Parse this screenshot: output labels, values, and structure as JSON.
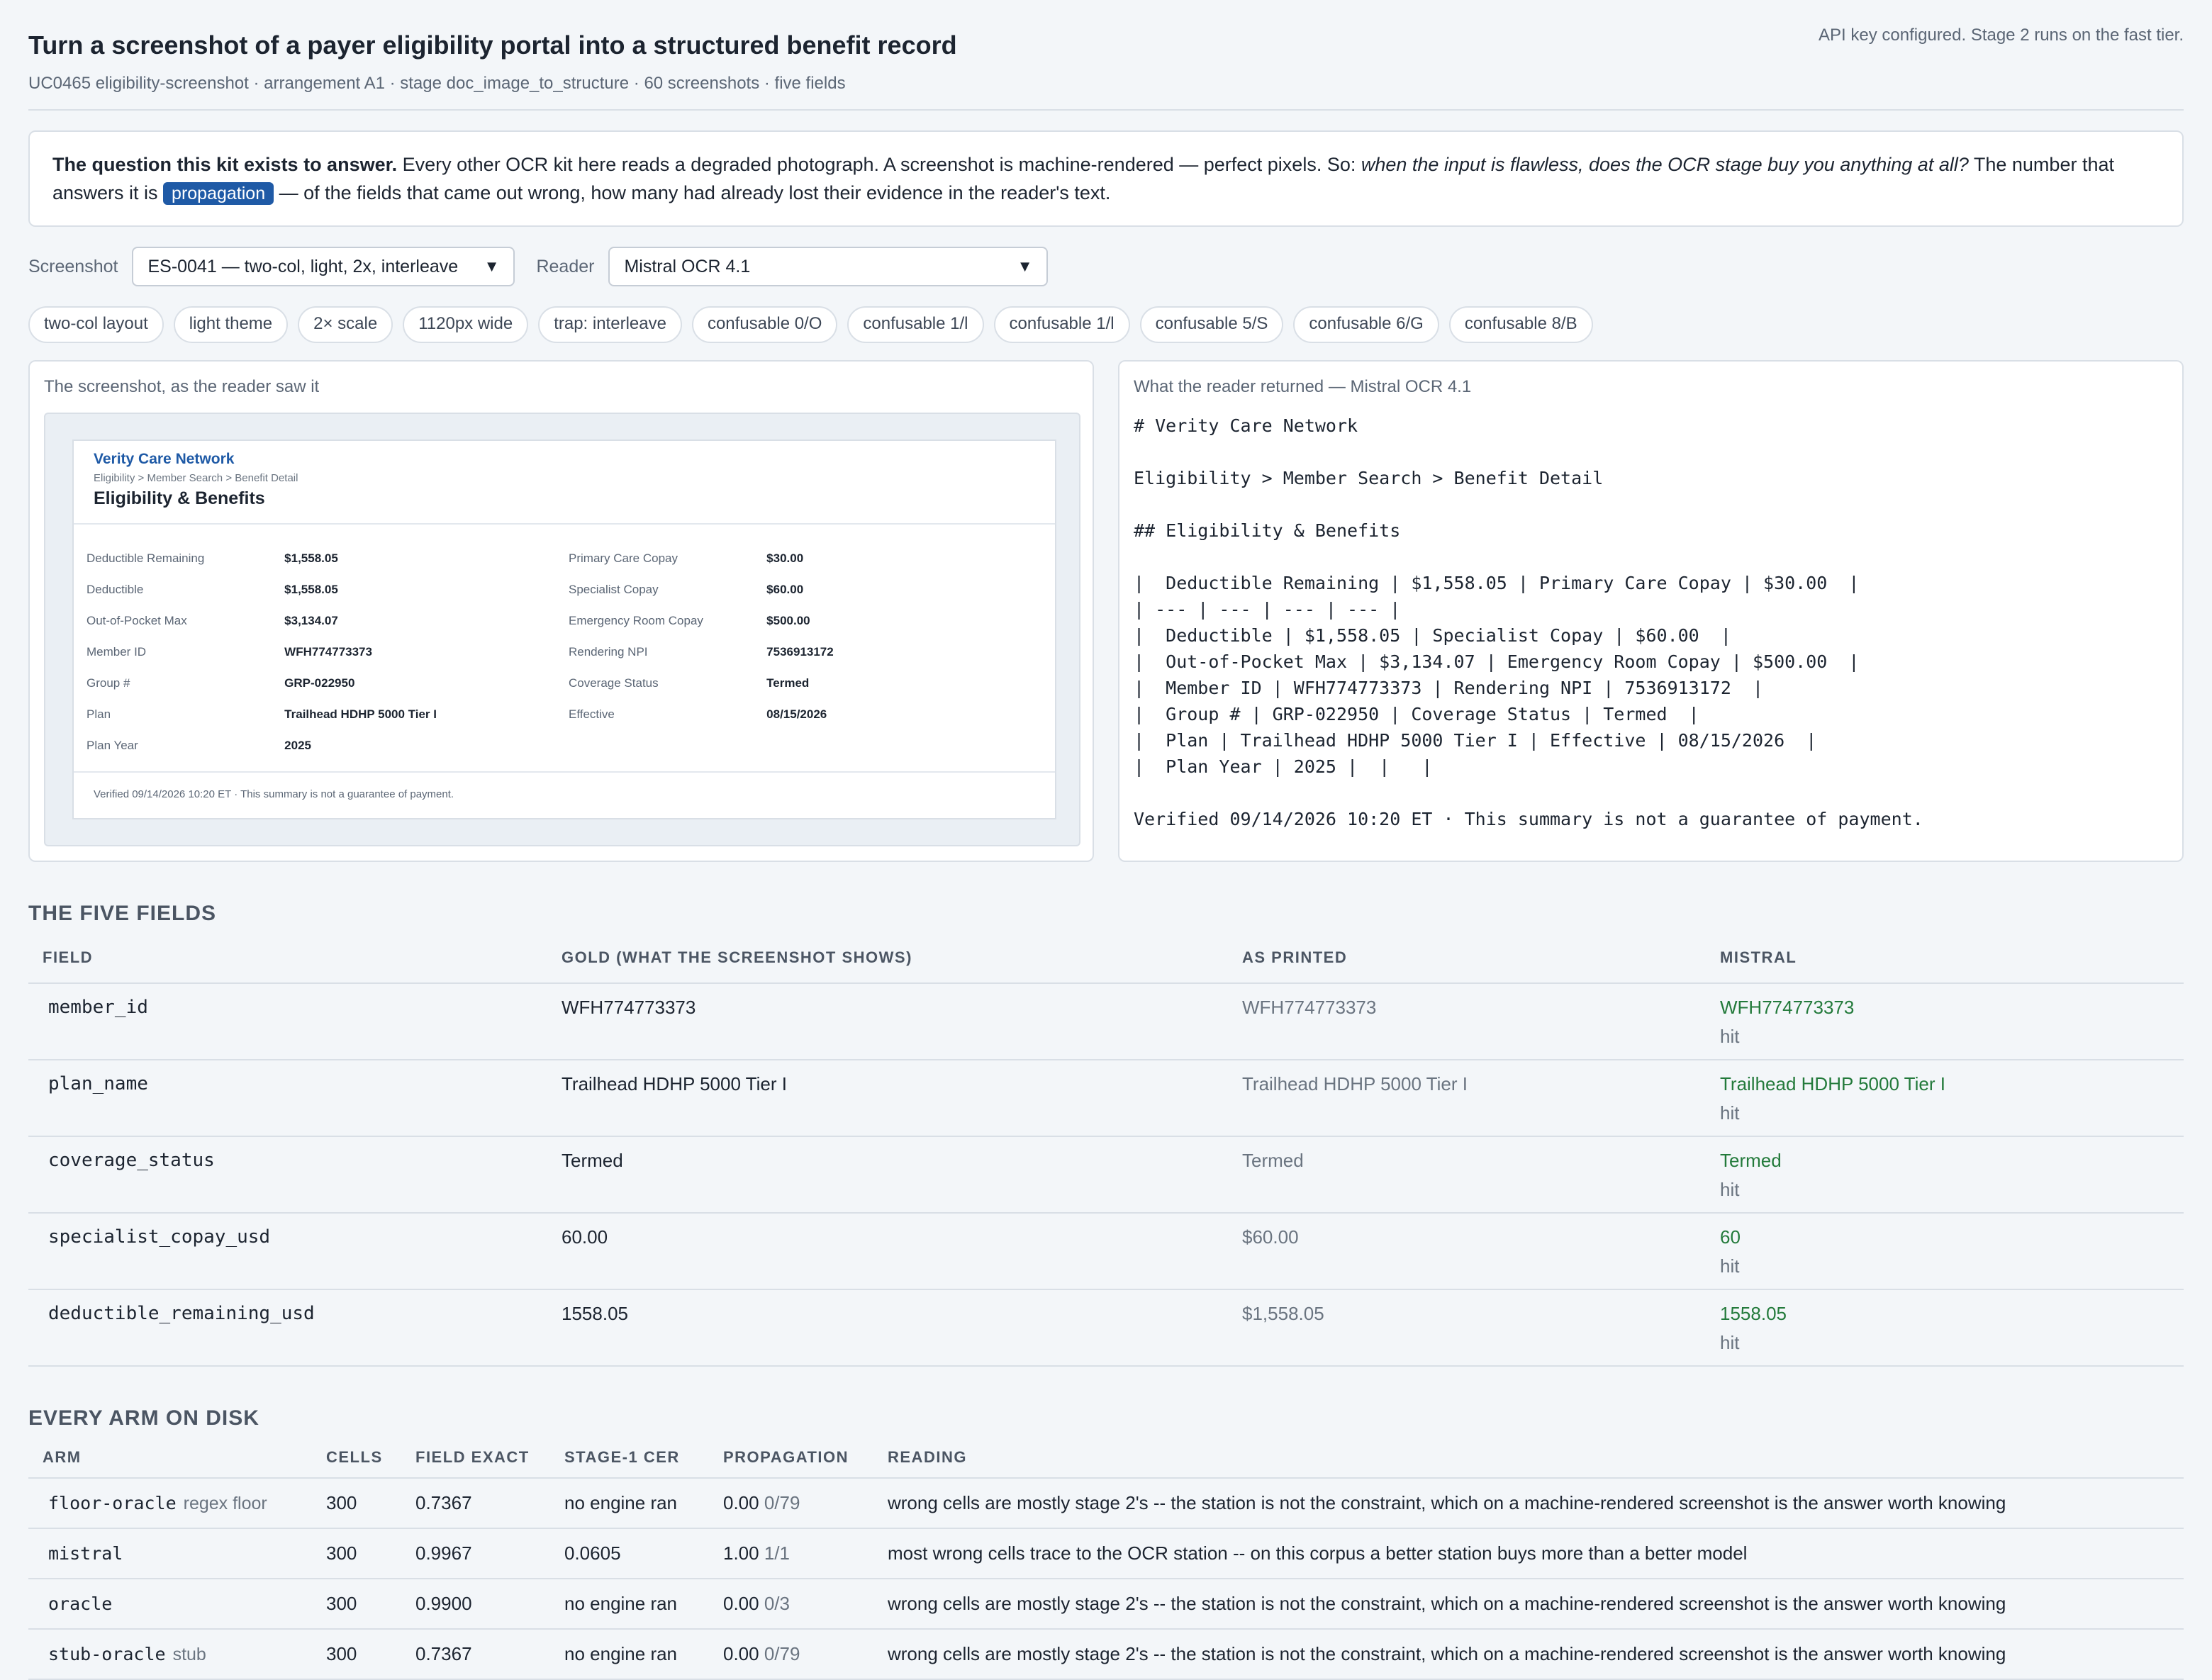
{
  "header": {
    "title": "Turn a screenshot of a payer eligibility portal into a structured benefit record",
    "subtitle": "UC0465 eligibility-screenshot · arrangement A1 · stage doc_image_to_structure · 60 screenshots · five fields",
    "api_status": "API key configured. Stage 2 runs on the fast tier."
  },
  "question": {
    "lead": "The question this kit exists to answer.",
    "text1": " Every other OCR kit here reads a degraded photograph. A screenshot is machine-rendered — perfect pixels. So: ",
    "italic": "when the input is flawless, does the OCR stage buy you anything at all?",
    "text2": " The number that answers it is ",
    "badge": "propagation",
    "text3": " — of the fields that came out wrong, how many had already lost their evidence in the reader's text."
  },
  "controls": {
    "screenshot_label": "Screenshot",
    "screenshot_value": "ES-0041 — two-col, light, 2x, interleave",
    "reader_label": "Reader",
    "reader_value": "Mistral OCR 4.1"
  },
  "chips": [
    "two-col layout",
    "light theme",
    "2× scale",
    "1120px wide",
    "trap: interleave",
    "confusable 0/O",
    "confusable 1/l",
    "confusable 1/l",
    "confusable 5/S",
    "confusable 6/G",
    "confusable 8/B"
  ],
  "left_panel": {
    "title": "The screenshot, as the reader saw it",
    "portal": {
      "brand": "Verity Care Network",
      "breadcrumb": "Eligibility > Member Search > Benefit Detail",
      "title": "Eligibility & Benefits",
      "rows": [
        {
          "l1": "Deductible Remaining",
          "v1": "$1,558.05",
          "l2": "Primary Care Copay",
          "v2": "$30.00"
        },
        {
          "l1": "Deductible",
          "v1": "$1,558.05",
          "l2": "Specialist Copay",
          "v2": "$60.00"
        },
        {
          "l1": "Out-of-Pocket Max",
          "v1": "$3,134.07",
          "l2": "Emergency Room Copay",
          "v2": "$500.00"
        },
        {
          "l1": "Member ID",
          "v1": "WFH774773373",
          "l2": "Rendering NPI",
          "v2": "7536913172"
        },
        {
          "l1": "Group #",
          "v1": "GRP-022950",
          "l2": "Coverage Status",
          "v2": "Termed"
        },
        {
          "l1": "Plan",
          "v1": "Trailhead HDHP 5000 Tier I",
          "l2": "Effective",
          "v2": "08/15/2026"
        },
        {
          "l1": "Plan Year",
          "v1": "2025",
          "l2": "",
          "v2": ""
        }
      ],
      "footer": "Verified 09/14/2026 10:20 ET · This summary is not a guarantee of payment."
    }
  },
  "right_panel": {
    "title": "What the reader returned — Mistral OCR 4.1",
    "lines": [
      "# Verity Care Network",
      "",
      "Eligibility > Member Search > Benefit Detail",
      "",
      "## Eligibility & Benefits",
      "",
      "|  Deductible Remaining | $1,558.05 | Primary Care Copay | $30.00  |",
      "| --- | --- | --- | --- |",
      "|  Deductible | $1,558.05 | Specialist Copay | $60.00  |",
      "|  Out-of-Pocket Max | $3,134.07 | Emergency Room Copay | $500.00  |",
      "|  Member ID | WFH774773373 | Rendering NPI | 7536913172  |",
      "|  Group # | GRP-022950 | Coverage Status | Termed  |",
      "|  Plan | Trailhead HDHP 5000 Tier I | Effective | 08/15/2026  |",
      "|  Plan Year | 2025 |  |   |",
      "",
      "Verified 09/14/2026 10:20 ET · This summary is not a guarantee of payment."
    ]
  },
  "fields_section": {
    "heading": "THE FIVE FIELDS",
    "columns": [
      "FIELD",
      "GOLD (WHAT THE SCREENSHOT SHOWS)",
      "AS PRINTED",
      "MISTRAL"
    ],
    "rows": [
      {
        "field": "member_id",
        "gold": "WFH774773373",
        "printed": "WFH774773373",
        "value": "WFH774773373",
        "result": "hit"
      },
      {
        "field": "plan_name",
        "gold": "Trailhead HDHP 5000 Tier I",
        "printed": "Trailhead HDHP 5000 Tier I",
        "value": "Trailhead HDHP 5000 Tier I",
        "result": "hit"
      },
      {
        "field": "coverage_status",
        "gold": "Termed",
        "printed": "Termed",
        "value": "Termed",
        "result": "hit"
      },
      {
        "field": "specialist_copay_usd",
        "gold": "60.00",
        "printed": "$60.00",
        "value": "60",
        "result": "hit"
      },
      {
        "field": "deductible_remaining_usd",
        "gold": "1558.05",
        "printed": "$1,558.05",
        "value": "1558.05",
        "result": "hit"
      }
    ]
  },
  "arms_section": {
    "heading": "EVERY ARM ON DISK",
    "columns": [
      "ARM",
      "CELLS",
      "FIELD EXACT",
      "STAGE-1 CER",
      "PROPAGATION",
      "READING"
    ],
    "rows": [
      {
        "arm": "floor-oracle",
        "tag": "regex floor",
        "cells": "300",
        "exact": "0.7367",
        "cer": "no engine ran",
        "prop": "0.00",
        "frac": "0/79",
        "reading": "wrong cells are mostly stage 2's -- the station is not the constraint, which on a machine-rendered screenshot is the answer worth knowing"
      },
      {
        "arm": "mistral",
        "tag": "",
        "cells": "300",
        "exact": "0.9967",
        "cer": "0.0605",
        "prop": "1.00",
        "frac": "1/1",
        "reading": "most wrong cells trace to the OCR station -- on this corpus a better station buys more than a better model"
      },
      {
        "arm": "oracle",
        "tag": "",
        "cells": "300",
        "exact": "0.9900",
        "cer": "no engine ran",
        "prop": "0.00",
        "frac": "0/3",
        "reading": "wrong cells are mostly stage 2's -- the station is not the constraint, which on a machine-rendered screenshot is the answer worth knowing"
      },
      {
        "arm": "stub-oracle",
        "tag": "stub",
        "cells": "300",
        "exact": "0.7367",
        "cer": "no engine ran",
        "prop": "0.00",
        "frac": "0/79",
        "reading": "wrong cells are mostly stage 2's -- the station is not the constraint, which on a machine-rendered screenshot is the answer worth knowing"
      }
    ]
  }
}
